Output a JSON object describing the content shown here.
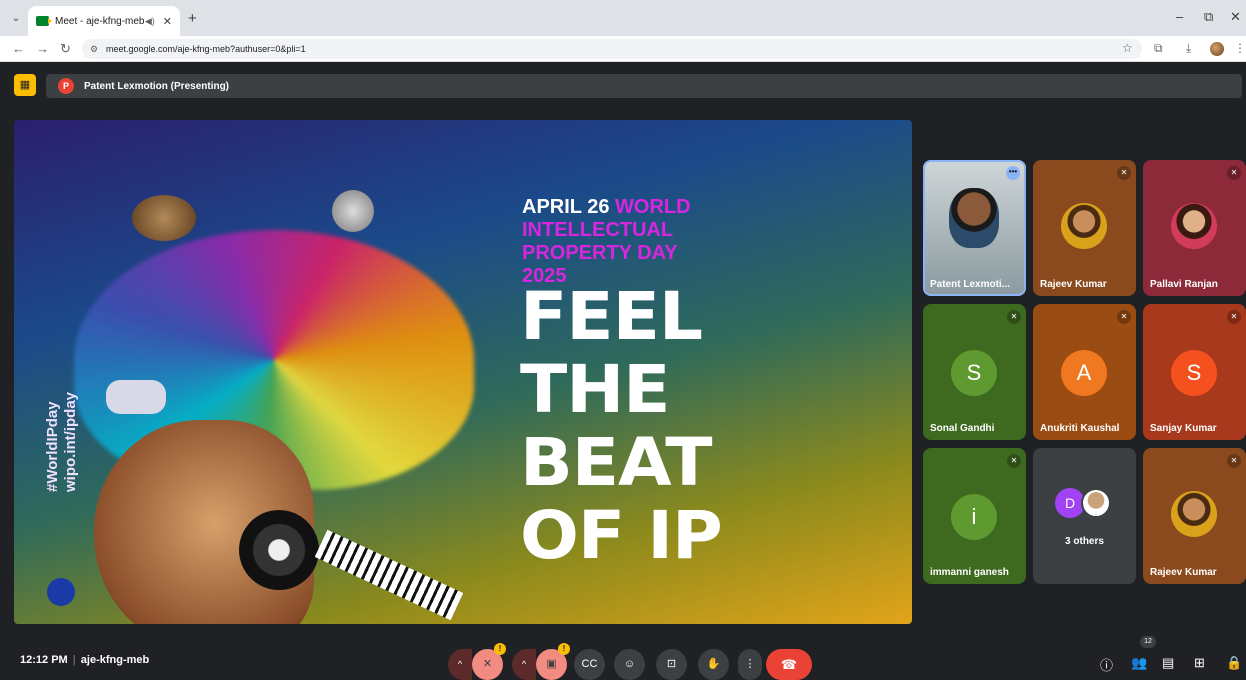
{
  "browser": {
    "tab_title": "Meet - aje-kfng-meb",
    "url": "meet.google.com/aje-kfng-meb?authuser=0&pli=1"
  },
  "presentation": {
    "presenter_initial": "P",
    "label": "Patent Lexmotion (Presenting)"
  },
  "slide": {
    "line1_white": "APRIL 26",
    "line1_magenta": " WORLD",
    "line2": "INTELLECTUAL",
    "line3": "PROPERTY DAY",
    "line4": "2025",
    "big1": "FEEL",
    "big2": "THE",
    "big3": "BEAT",
    "big4": "OF IP",
    "hashtag": "#WorldIPday",
    "site": "wipo.int/ipday"
  },
  "participants": [
    {
      "name": "Patent Lexmoti..."
    },
    {
      "name": "Rajeev Kumar"
    },
    {
      "name": "Pallavi Ranjan"
    },
    {
      "name": "Sonal Gandhi",
      "initial": "S",
      "color": "#5f9a30"
    },
    {
      "name": "Anukriti Kaushal",
      "initial": "A",
      "color": "#f07820"
    },
    {
      "name": "Sanjay Kumar",
      "initial": "S",
      "color": "#f4511e"
    },
    {
      "name": "immanni ganesh",
      "initial": "i",
      "color": "#5f9a30"
    },
    {
      "name": "3 others",
      "initial": "D"
    },
    {
      "name": "Rajeev Kumar"
    }
  ],
  "bottom": {
    "time": "12:12 PM",
    "meeting_code": "aje-kfng-meb",
    "people_count": "12"
  },
  "colors": {
    "meet_bg": "#202124",
    "end_call": "#ea4335",
    "accent": "#8ab4f8"
  }
}
